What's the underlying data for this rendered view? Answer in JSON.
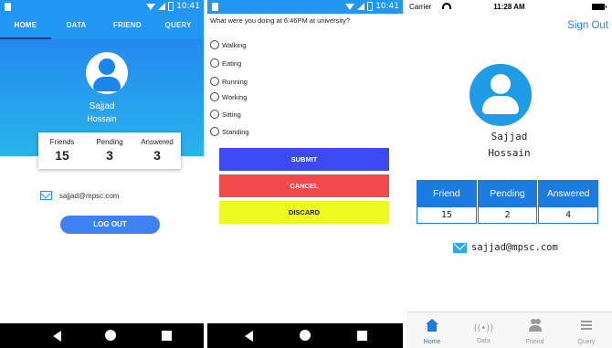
{
  "android_status": {
    "time": "10:41"
  },
  "home": {
    "tabs": [
      {
        "label": "HOME",
        "active": true
      },
      {
        "label": "DATA",
        "active": false
      },
      {
        "label": "FRIEND",
        "active": false
      },
      {
        "label": "QUERY",
        "active": false
      }
    ],
    "first_name": "Sajjad",
    "last_name": "Hossain",
    "stats": [
      {
        "label": "Friends",
        "value": "15"
      },
      {
        "label": "Pending",
        "value": "3"
      },
      {
        "label": "Answered",
        "value": "3"
      }
    ],
    "email": "sajjad@mpsc.com",
    "logout_label": "LOG OUT"
  },
  "survey": {
    "question": "What were you doing at 6:46PM at university?",
    "options": [
      "Walking",
      "Eating",
      "Running",
      "Working",
      "Sitting",
      "Standing"
    ],
    "submit_label": "SUBMIT",
    "cancel_label": "CANCEL",
    "discard_label": "DISCARD"
  },
  "ios": {
    "carrier": "Carrier",
    "time": "11:28 AM",
    "sign_out_label": "Sign Out",
    "first_name": "Sajjad",
    "last_name": "Hossain",
    "stats": [
      {
        "label": "Friend",
        "value": "15"
      },
      {
        "label": "Pending",
        "value": "2"
      },
      {
        "label": "Answered",
        "value": "4"
      }
    ],
    "email": "sajjad@mpsc.com",
    "tabs": [
      {
        "label": "Home",
        "icon": "home-icon",
        "active": true
      },
      {
        "label": "Data",
        "icon": "data-icon",
        "active": false
      },
      {
        "label": "Friend",
        "icon": "friends-icon",
        "active": false
      },
      {
        "label": "Query",
        "icon": "query-icon",
        "active": false
      }
    ]
  },
  "colors": {
    "android_primary": "#2196f3",
    "submit": "#3d49f2",
    "cancel": "#f24a4a",
    "discard": "#eefa1e",
    "ios_accent": "#1c7be0"
  }
}
